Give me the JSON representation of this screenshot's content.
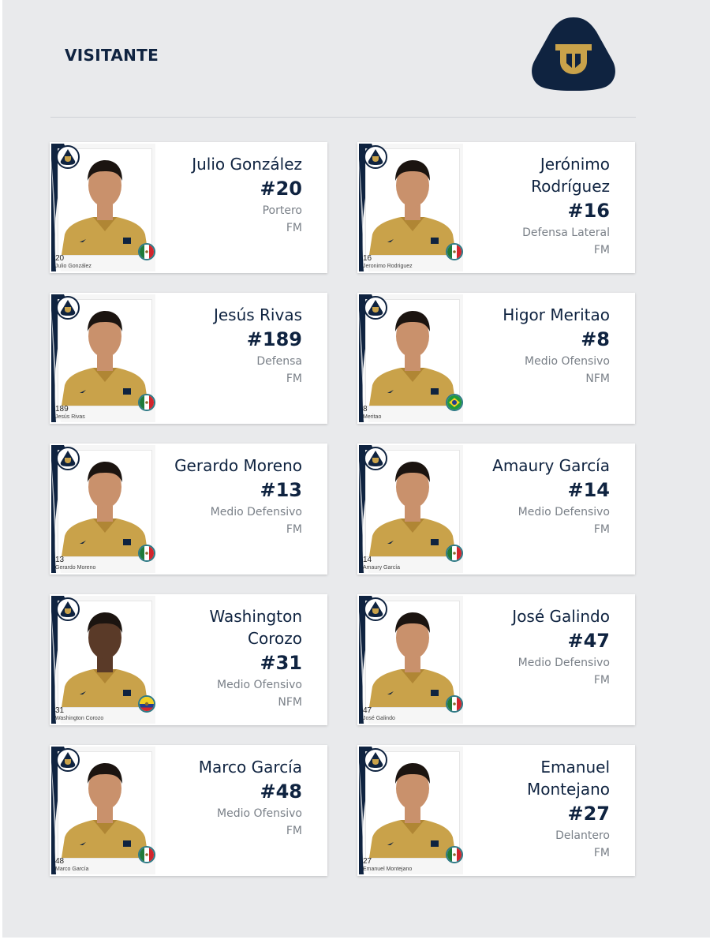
{
  "header": {
    "title": "VISITANTE",
    "logo_icon": "pumas-logo-icon"
  },
  "colors": {
    "navy": "#0f2340",
    "gold": "#c9a24a",
    "background": "#e9eaec",
    "muted_text": "#7a8088"
  },
  "players": [
    {
      "name": "Julio González",
      "number": "#20",
      "position": "Portero",
      "status": "FM",
      "sticker_number": "20",
      "sticker_name": "Julio González",
      "flag": "mexico-flag-icon"
    },
    {
      "name": "Jerónimo Rodríguez",
      "number": "#16",
      "position": "Defensa Lateral",
      "status": "FM",
      "sticker_number": "16",
      "sticker_name": "Jeronimo Rodriguez",
      "flag": "mexico-flag-icon"
    },
    {
      "name": "Jesús Rivas",
      "number": "#189",
      "position": "Defensa",
      "status": "FM",
      "sticker_number": "189",
      "sticker_name": "Jesús Rivas",
      "flag": "mexico-flag-icon"
    },
    {
      "name": "Higor Meritao",
      "number": "#8",
      "position": "Medio Ofensivo",
      "status": "NFM",
      "sticker_number": "8",
      "sticker_name": "Meritao",
      "flag": "brazil-flag-icon"
    },
    {
      "name": "Gerardo Moreno",
      "number": "#13",
      "position": "Medio Defensivo",
      "status": "FM",
      "sticker_number": "13",
      "sticker_name": "Gerardo Moreno",
      "flag": "mexico-flag-icon"
    },
    {
      "name": "Amaury García",
      "number": "#14",
      "position": "Medio Defensivo",
      "status": "FM",
      "sticker_number": "14",
      "sticker_name": "Amaury García",
      "flag": "mexico-flag-icon"
    },
    {
      "name": "Washington Corozo",
      "number": "#31",
      "position": "Medio Ofensivo",
      "status": "NFM",
      "sticker_number": "31",
      "sticker_name": "Washington Corozo",
      "flag": "ecuador-flag-icon"
    },
    {
      "name": "José Galindo",
      "number": "#47",
      "position": "Medio Defensivo",
      "status": "FM",
      "sticker_number": "47",
      "sticker_name": "José Galindo",
      "flag": "mexico-flag-icon"
    },
    {
      "name": "Marco García",
      "number": "#48",
      "position": "Medio Ofensivo",
      "status": "FM",
      "sticker_number": "48",
      "sticker_name": "Marco García",
      "flag": "mexico-flag-icon"
    },
    {
      "name": "Emanuel Montejano",
      "number": "#27",
      "position": "Delantero",
      "status": "FM",
      "sticker_number": "27",
      "sticker_name": "Emanuel Montejano",
      "flag": "mexico-flag-icon"
    }
  ]
}
